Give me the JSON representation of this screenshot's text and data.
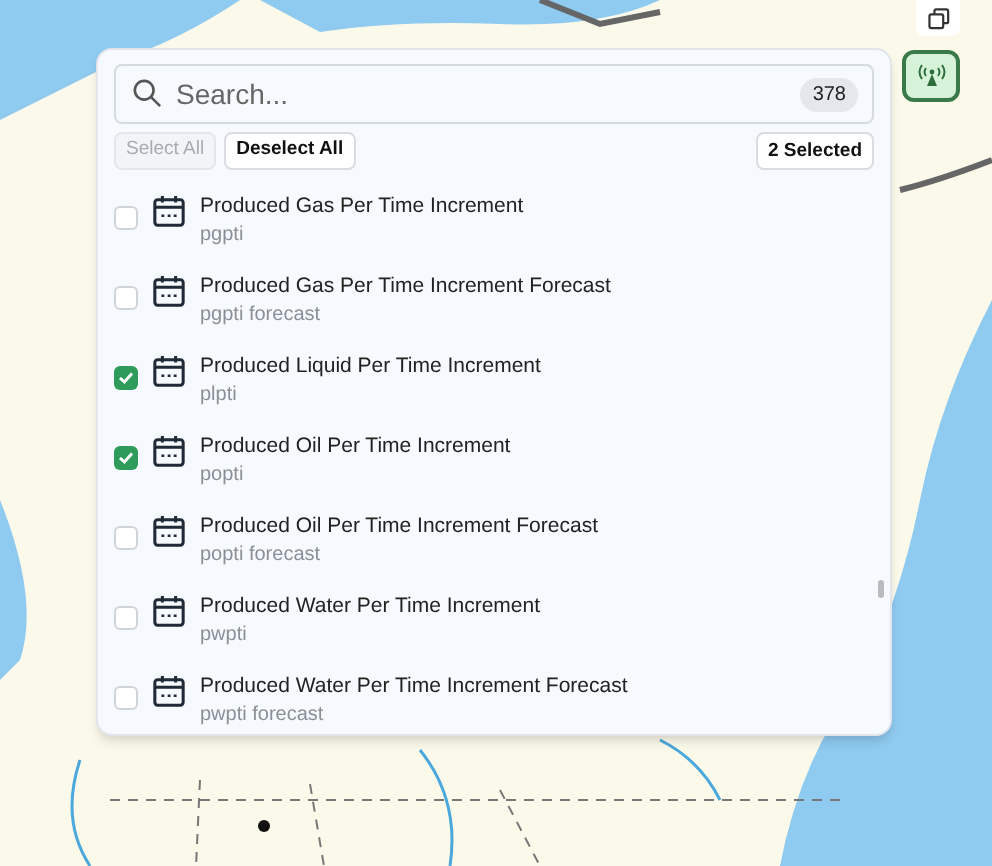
{
  "search": {
    "placeholder": "Search...",
    "count": "378"
  },
  "actions": [
    {
      "label": "Select All",
      "disabled": true
    },
    {
      "label": "Deselect All",
      "disabled": false
    }
  ],
  "selected_count": "2 Selected",
  "items": [
    {
      "title": "Produced Gas Per Time Increment",
      "subtitle": "pgpti",
      "checked": false
    },
    {
      "title": "Produced Gas Per Time Increment Forecast",
      "subtitle": "pgpti forecast",
      "checked": false
    },
    {
      "title": "Produced Liquid Per Time Increment",
      "subtitle": "plpti",
      "checked": true
    },
    {
      "title": "Produced Oil Per Time Increment",
      "subtitle": "popti",
      "checked": true
    },
    {
      "title": "Produced Oil Per Time Increment Forecast",
      "subtitle": "popti forecast",
      "checked": false
    },
    {
      "title": "Produced Water Per Time Increment",
      "subtitle": "pwpti",
      "checked": false
    },
    {
      "title": "Produced Water Per Time Increment Forecast",
      "subtitle": "pwpti forecast",
      "checked": false
    }
  ]
}
